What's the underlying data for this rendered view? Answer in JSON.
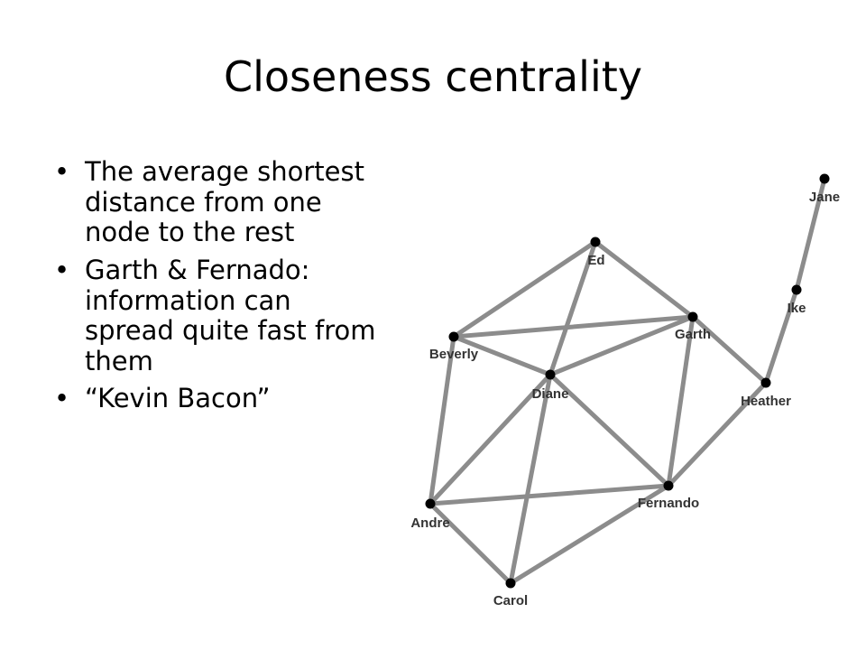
{
  "title": "Closeness centrality",
  "bullets": [
    "The average shortest distance from one node to the rest",
    "Garth & Fernado: information can spread quite fast from them",
    "“Kevin Bacon”"
  ],
  "bullet_symbol": "•",
  "graph": {
    "edge_color": "#8c8c8c",
    "node_color": "#000000",
    "nodes": [
      "Jane",
      "Ike",
      "Heather",
      "Garth",
      "Ed",
      "Beverly",
      "Diane",
      "Fernando",
      "Andre",
      "Carol"
    ],
    "edges": [
      [
        "Jane",
        "Ike"
      ],
      [
        "Ike",
        "Heather"
      ],
      [
        "Heather",
        "Garth"
      ],
      [
        "Heather",
        "Fernando"
      ],
      [
        "Ed",
        "Beverly"
      ],
      [
        "Ed",
        "Garth"
      ],
      [
        "Ed",
        "Diane"
      ],
      [
        "Beverly",
        "Garth"
      ],
      [
        "Beverly",
        "Diane"
      ],
      [
        "Beverly",
        "Andre"
      ],
      [
        "Garth",
        "Diane"
      ],
      [
        "Garth",
        "Fernando"
      ],
      [
        "Diane",
        "Fernando"
      ],
      [
        "Diane",
        "Andre"
      ],
      [
        "Diane",
        "Carol"
      ],
      [
        "Andre",
        "Fernando"
      ],
      [
        "Andre",
        "Carol"
      ],
      [
        "Carol",
        "Fernando"
      ]
    ]
  }
}
